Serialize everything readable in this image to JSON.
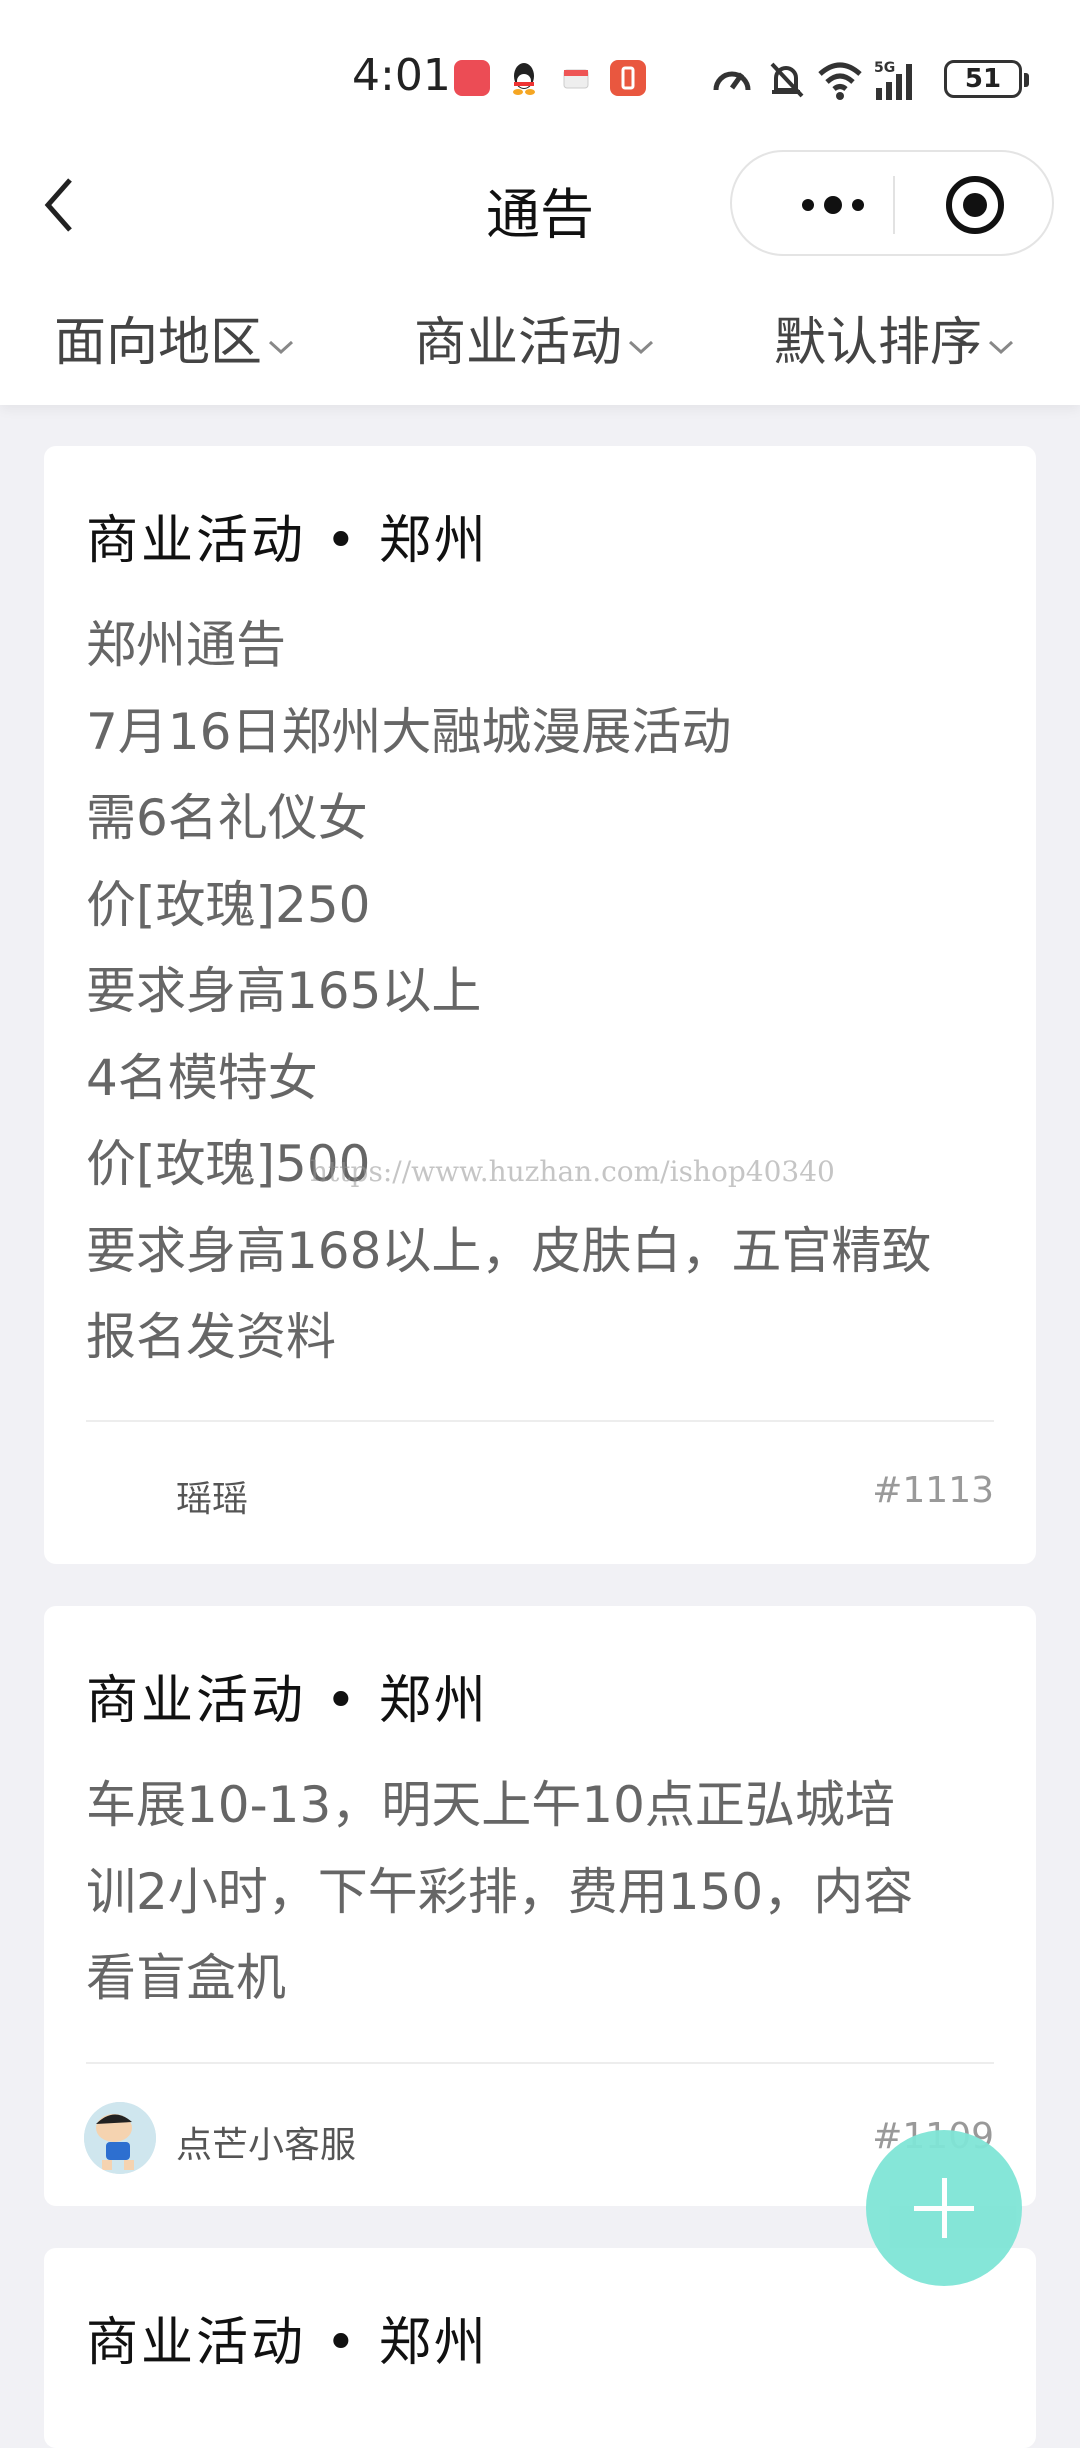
{
  "status_bar": {
    "time": "4:01",
    "battery": "51",
    "network": "5G",
    "icons": [
      "huawei-app-icon",
      "qq-icon",
      "cube-app-icon",
      "notification-app-icon",
      "speed-icon",
      "mute-icon",
      "wifi-icon",
      "signal-icon",
      "battery-icon"
    ]
  },
  "nav": {
    "title": "通告",
    "back_icon": "chevron-left-icon",
    "more_icon": "more-dots-icon",
    "close_icon": "target-circle-icon"
  },
  "filters": [
    {
      "label": "面向地区"
    },
    {
      "label": "商业活动"
    },
    {
      "label": "默认排序"
    }
  ],
  "watermark": "https://www.huzhan.com/ishop40340",
  "posts": [
    {
      "header": "商业活动 • 郑州",
      "lines": [
        "郑州通告",
        "7月16日郑州大融城漫展活动",
        "需6名礼仪女",
        "价[玫瑰]250",
        "要求身高165以上",
        "4名模特女",
        "价[玫瑰]500",
        "要求身高168以上，皮肤白，五官精致",
        "报名发资料"
      ],
      "author": "瑶瑶",
      "number": "#1113"
    },
    {
      "header": "商业活动 • 郑州",
      "lines": [
        "车展10-13，明天上午10点正弘城培",
        "训2小时，下午彩排，费用150，内容",
        "看盲盒机"
      ],
      "author": "点芒小客服",
      "number": "#1109"
    },
    {
      "header": "商业活动 • 郑州"
    }
  ],
  "fab": {
    "icon": "plus-icon"
  },
  "colors": {
    "fab": "#7fe5d6",
    "background": "#f1f1f5",
    "body_text": "#666666"
  }
}
